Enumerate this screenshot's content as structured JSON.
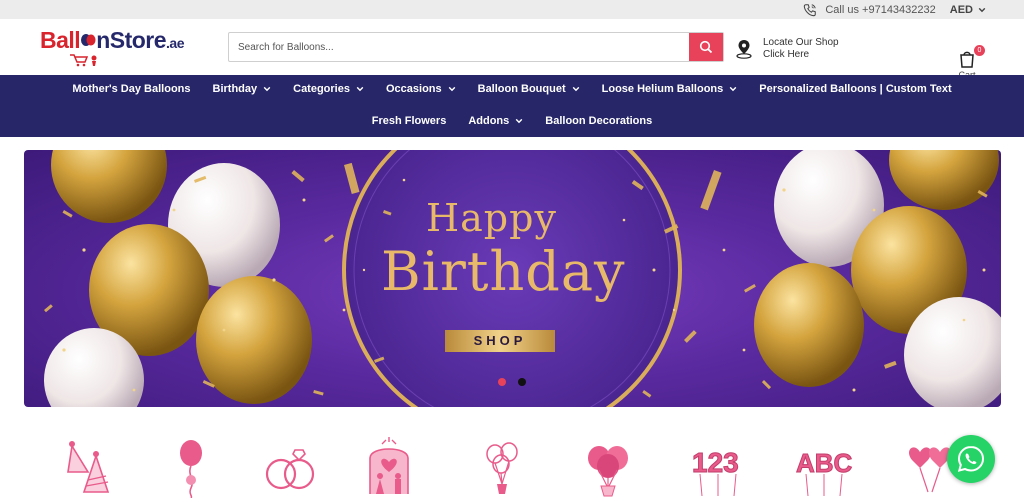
{
  "topbar": {
    "call_label": "Call us +97143432232",
    "currency": "AED"
  },
  "header": {
    "logo": {
      "part1": "Ball",
      "part2": "nStore",
      "part3": ".ae"
    },
    "search": {
      "placeholder": "Search for Balloons..."
    },
    "locate": {
      "line1": "Locate Our Shop",
      "line2": "Click Here"
    },
    "cart": {
      "label": "Cart",
      "count": "0"
    }
  },
  "nav": {
    "row1": [
      {
        "label": "Mother's Day Balloons",
        "dropdown": false
      },
      {
        "label": "Birthday",
        "dropdown": true
      },
      {
        "label": "Categories",
        "dropdown": true
      },
      {
        "label": "Occasions",
        "dropdown": true
      },
      {
        "label": "Balloon Bouquet",
        "dropdown": true
      },
      {
        "label": "Loose Helium Balloons",
        "dropdown": true
      },
      {
        "label": "Personalized Balloons | Custom Text",
        "dropdown": false
      }
    ],
    "row2": [
      {
        "label": "Fresh Flowers",
        "dropdown": false
      },
      {
        "label": "Addons",
        "dropdown": true
      },
      {
        "label": "Balloon Decorations",
        "dropdown": false
      }
    ]
  },
  "banner": {
    "line1": "Happy",
    "line2": "Birthday",
    "button": "SHOP",
    "slides": 2,
    "active_slide": 1
  },
  "categories": [
    {
      "icon": "party-hats-icon"
    },
    {
      "icon": "balloon-single-icon"
    },
    {
      "icon": "wedding-rings-icon"
    },
    {
      "icon": "couple-arch-icon"
    },
    {
      "icon": "balloon-bunch-outline-icon"
    },
    {
      "icon": "balloon-bouquet-icon"
    },
    {
      "icon": "number-balloons-icon"
    },
    {
      "icon": "letter-balloons-icon"
    },
    {
      "icon": "heart-balloons-icon"
    }
  ],
  "colors": {
    "nav_bg": "#262669",
    "accent": "#e8425a",
    "logo_red": "#d9232d",
    "logo_navy": "#25286b",
    "category_pink": "#e85b8a",
    "whatsapp": "#25d366"
  }
}
